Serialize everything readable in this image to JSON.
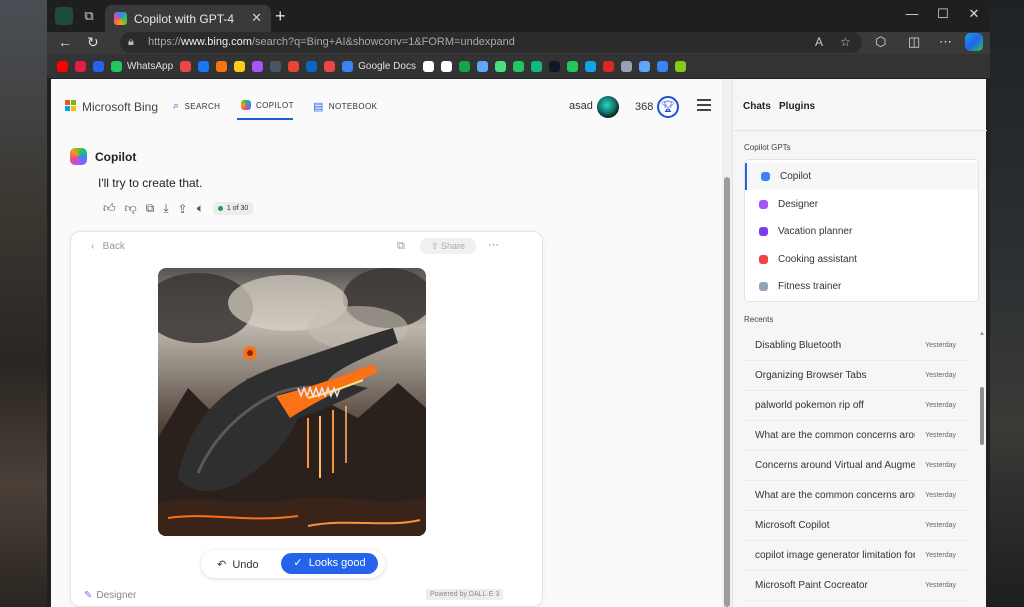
{
  "browser": {
    "tab_title": "Copilot with GPT-4",
    "url_prefix": "https://",
    "url_host": "www.bing.com",
    "url_rest": "/search?q=Bing+AI&showconv=1&FORM=undexpand"
  },
  "bookmarks": [
    {
      "label": "",
      "color": "#ff0000"
    },
    {
      "label": "",
      "color": "#e11d48"
    },
    {
      "label": "",
      "color": "#2563eb"
    },
    {
      "label": "WhatsApp",
      "color": "#22c55e"
    },
    {
      "label": "",
      "color": "#ef4444"
    },
    {
      "label": "",
      "color": "#1877f2"
    },
    {
      "label": "",
      "color": "#f97316"
    },
    {
      "label": "",
      "color": "#facc15"
    },
    {
      "label": "",
      "color": "#a855f7"
    },
    {
      "label": "",
      "color": "#4b5563"
    },
    {
      "label": "",
      "color": "#ea4335"
    },
    {
      "label": "",
      "color": "#0a66c2"
    },
    {
      "label": "",
      "color": "#ef4444"
    },
    {
      "label": "Google Docs",
      "color": "#3b82f6"
    },
    {
      "label": "",
      "color": "#ffffff"
    },
    {
      "label": "",
      "color": "#ffffff"
    },
    {
      "label": "",
      "color": "#16a34a"
    },
    {
      "label": "",
      "color": "#60a5fa"
    },
    {
      "label": "",
      "color": "#4ade80"
    },
    {
      "label": "",
      "color": "#22c55e"
    },
    {
      "label": "",
      "color": "#10b981"
    },
    {
      "label": "",
      "color": "#111827"
    },
    {
      "label": "",
      "color": "#22c55e"
    },
    {
      "label": "",
      "color": "#0ea5e9"
    },
    {
      "label": "",
      "color": "#dc2626"
    },
    {
      "label": "",
      "color": "#94a3b8"
    },
    {
      "label": "",
      "color": "#60a5fa"
    },
    {
      "label": "",
      "color": "#3b82f6"
    },
    {
      "label": "",
      "color": "#84cc16"
    }
  ],
  "header": {
    "brand": "Microsoft Bing",
    "nav": [
      {
        "label": "SEARCH",
        "icon": "search-icon"
      },
      {
        "label": "COPILOT",
        "icon": "copilot-icon"
      },
      {
        "label": "NOTEBOOK",
        "icon": "notebook-icon"
      }
    ],
    "user_name": "asad",
    "points": "368"
  },
  "chat": {
    "assistant_name": "Copilot",
    "message": "I'll try to create that.",
    "counter": "1 of 30",
    "card": {
      "back_label": "Back",
      "share_label": "Share",
      "undo_label": "Undo",
      "looks_good_label": "Looks good",
      "designer_label": "Designer",
      "powered_by": "Powered by DALL·E 3"
    }
  },
  "sidebar": {
    "tabs": [
      "Chats",
      "Plugins"
    ],
    "gpts_heading": "Copilot GPTs",
    "gpts": [
      {
        "label": "Copilot",
        "color": "#3b82f6"
      },
      {
        "label": "Designer",
        "color": "#a855f7"
      },
      {
        "label": "Vacation planner",
        "color": "#7c3aed"
      },
      {
        "label": "Cooking assistant",
        "color": "#ef4444"
      },
      {
        "label": "Fitness trainer",
        "color": "#94a3b8"
      }
    ],
    "recents_heading": "Recents",
    "recents": [
      {
        "title": "Disabling Bluetooth",
        "time": "Yesterday"
      },
      {
        "title": "Organizing Browser Tabs",
        "time": "Yesterday"
      },
      {
        "title": "palworld pokemon rip off",
        "time": "Yesterday"
      },
      {
        "title": "What are the common concerns arou",
        "time": "Yesterday"
      },
      {
        "title": "Concerns around Virtual and Augmen",
        "time": "Yesterday"
      },
      {
        "title": "What are the common concerns arou",
        "time": "Yesterday"
      },
      {
        "title": "Microsoft Copilot",
        "time": "Yesterday"
      },
      {
        "title": "copilot image generator limitation for",
        "time": "Yesterday"
      },
      {
        "title": "Microsoft Paint Cocreator",
        "time": "Yesterday"
      }
    ]
  }
}
